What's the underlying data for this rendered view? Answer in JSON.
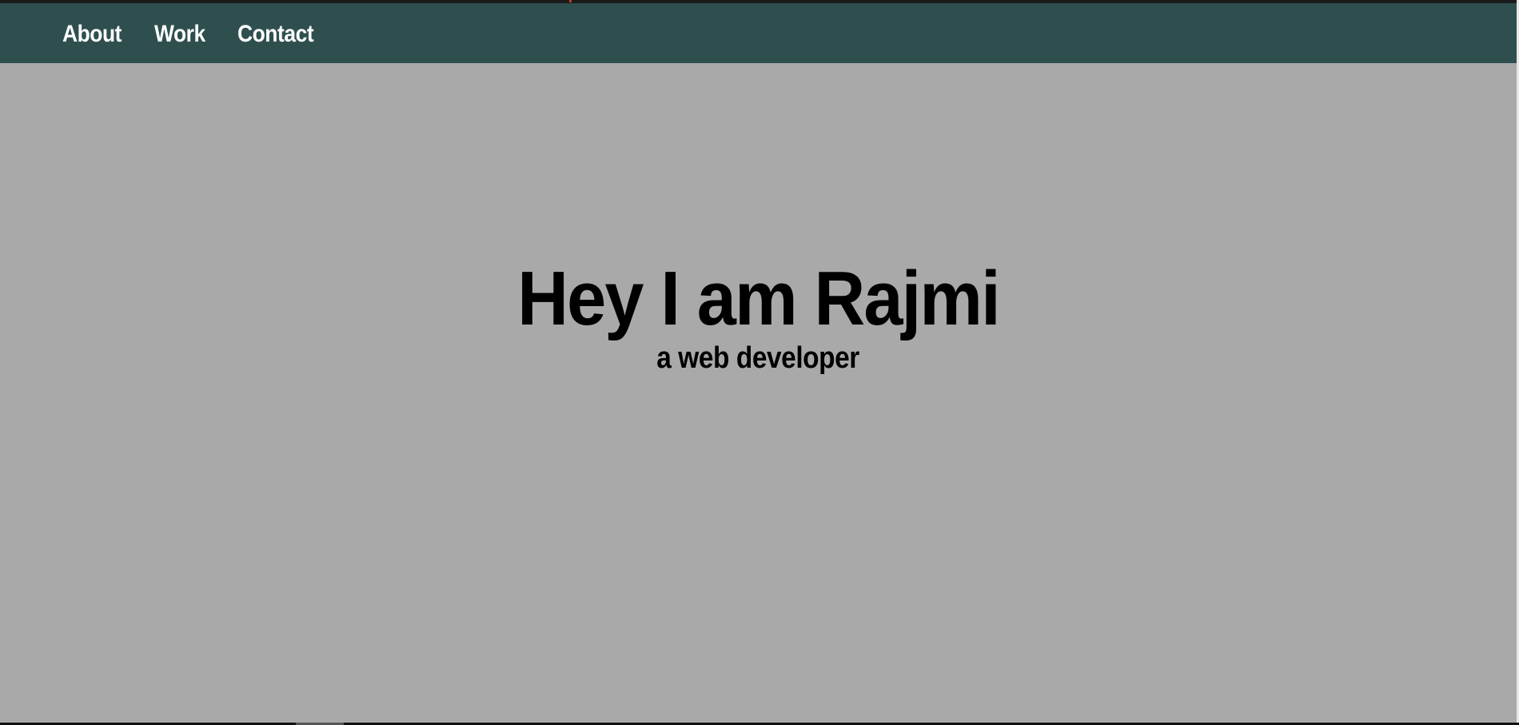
{
  "nav": {
    "links": [
      {
        "label": "About"
      },
      {
        "label": "Work"
      },
      {
        "label": "Contact"
      }
    ]
  },
  "hero": {
    "title": "Hey I am Rajmi",
    "subtitle": "a web developer"
  },
  "colors": {
    "navbar_bg": "#2f4f4f",
    "page_bg": "#a9a9a9",
    "nav_text": "#ffffff",
    "hero_text": "#000000"
  }
}
